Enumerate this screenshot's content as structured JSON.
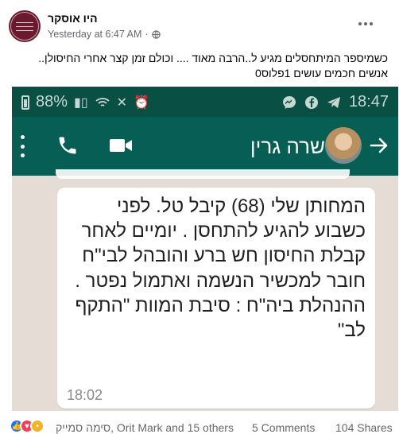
{
  "post": {
    "author": "היו אוסקר",
    "timestamp": "Yesterday at 6:47 AM",
    "separator": "·",
    "text": "כשמיספר המיתחסלים מגיע ל..הרבה מאוד ....  וכולם זמן קצר אחרי החיסולן.. אנשים חכמים עושים 1פלוס0",
    "privacy_icon": "globe-icon",
    "more_icon": "more-horizontal-icon"
  },
  "phone_screenshot": {
    "status_bar": {
      "battery": "88%",
      "time": "18:47",
      "icons_left": [
        "battery-icon",
        "signal-icon",
        "wifi-icon",
        "mute-icon",
        "alarm-icon"
      ],
      "icons_right": [
        "messenger-icon",
        "facebook-icon",
        "telegram-icon"
      ]
    },
    "header": {
      "contact_name": "שרה גרין",
      "icons": [
        "kebab-menu-icon",
        "call-icon",
        "video-call-icon",
        "back-arrow-icon"
      ],
      "colors": {
        "bar": "#075e54",
        "status": "#0a4f44"
      }
    },
    "message": {
      "text": "המחותן שלי (68) קיבל טל. לפני כשבוע להגיע להתחסן . יומיים לאחר קבלת החיסון חש ברע והובהל לבי\"ח חובר למכשיר הנשמה ואתמול נפטר . ההנהלת ביה\"ח : סיבת המוות \"התקף לב\"",
      "time": "18:02"
    }
  },
  "engagement": {
    "reactors": "סימה סמייק, Orit Mark and 15 others",
    "comments": "5 Comments",
    "shares": "104 Shares",
    "reaction_icons": [
      "like-icon",
      "love-icon",
      "sad-icon"
    ]
  }
}
